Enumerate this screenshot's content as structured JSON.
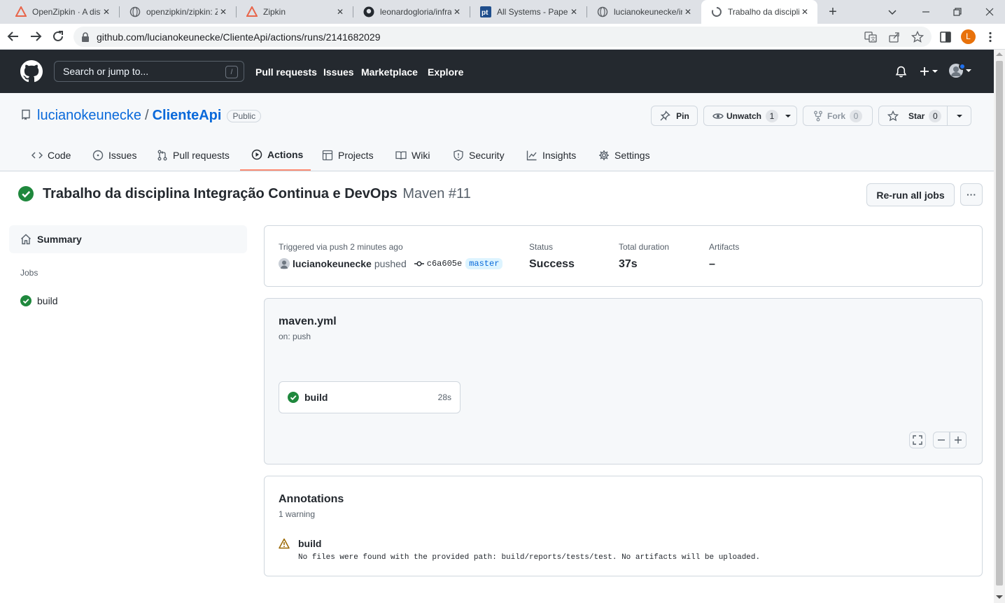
{
  "browser": {
    "tabs": [
      {
        "title": "OpenZipkin · A distributed tracing system"
      },
      {
        "title": "openzipkin/zipkin: Zipkin is a distributed tracing system"
      },
      {
        "title": "Zipkin"
      },
      {
        "title": "leonardogloria/infra-devops"
      },
      {
        "title": "All Systems - Papertrail"
      },
      {
        "title": "lucianokeunecke/integracao-continua"
      },
      {
        "title": "Trabalho da disciplina Integração Continua e DevOps"
      }
    ],
    "url": "github.com/lucianokeunecke/ClienteApi/actions/runs/2141682029",
    "profile_initial": "L"
  },
  "github": {
    "search_placeholder": "Search or jump to...",
    "search_shortcut": "/",
    "nav": [
      "Pull requests",
      "Issues",
      "Marketplace",
      "Explore"
    ]
  },
  "repo": {
    "owner": "lucianokeunecke",
    "separator": "/",
    "name": "ClienteApi",
    "visibility": "Public",
    "pin_label": "Pin",
    "unwatch_label": "Unwatch",
    "unwatch_count": "1",
    "fork_label": "Fork",
    "fork_count": "0",
    "star_label": "Star",
    "star_count": "0",
    "tabs": [
      "Code",
      "Issues",
      "Pull requests",
      "Actions",
      "Projects",
      "Wiki",
      "Security",
      "Insights",
      "Settings"
    ],
    "selected_tab": "Actions"
  },
  "run": {
    "title": "Trabalho da disciplina Integração Continua e DevOps",
    "workflow_ref": "Maven #11",
    "rerun_label": "Re-run all jobs",
    "more_label": "···"
  },
  "sidebar": {
    "summary": "Summary",
    "jobs_heading": "Jobs",
    "jobs": [
      {
        "name": "build",
        "status": "success"
      }
    ]
  },
  "summary": {
    "triggered": "Triggered via push 2 minutes ago",
    "actor": "lucianokeunecke",
    "action": "pushed",
    "commit": "c6a605e",
    "branch": "master",
    "status_label": "Status",
    "status_value": "Success",
    "duration_label": "Total duration",
    "duration_value": "37s",
    "artifacts_label": "Artifacts",
    "artifacts_value": "–"
  },
  "workflow": {
    "file": "maven.yml",
    "trigger": "on: push",
    "job_name": "build",
    "job_duration": "28s"
  },
  "annotations": {
    "title": "Annotations",
    "count": "1 warning",
    "items": [
      {
        "job": "build",
        "level": "warning",
        "message": "No files were found with the provided path: build/reports/tests/test. No artifacts will be uploaded."
      }
    ]
  },
  "colors": {
    "success": "#1f883d",
    "warning": "#9a6700",
    "accent": "#0969da",
    "header": "#24292f"
  }
}
